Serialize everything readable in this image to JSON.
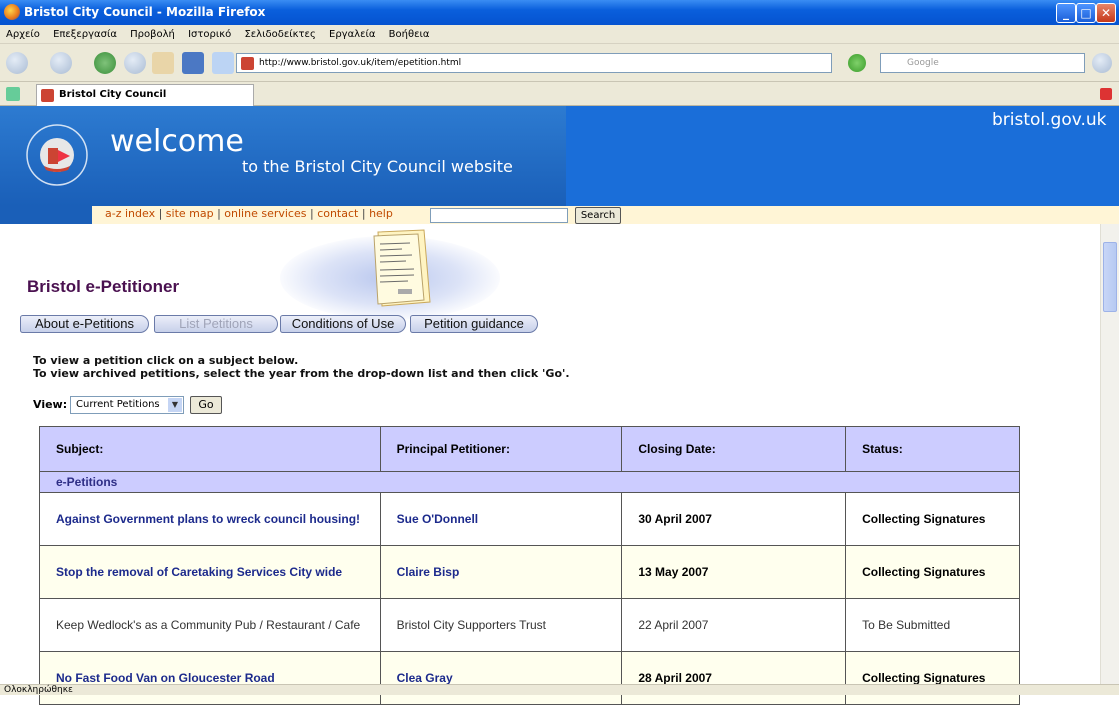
{
  "window": {
    "title": "Bristol City Council - Mozilla Firefox"
  },
  "menu": [
    "Αρχείο",
    "Επεξεργασία",
    "Προβολή",
    "Ιστορικό",
    "Σελιδοδείκτες",
    "Εργαλεία",
    "Βοήθεια"
  ],
  "navbar": {
    "url": "http://www.bristol.gov.uk/item/epetition.html",
    "search_placeholder": "Google"
  },
  "tab": {
    "title": "Bristol City Council"
  },
  "header": {
    "welcome": "welcome",
    "subtitle": "to the Bristol City Council website",
    "domain": "bristol.gov.uk",
    "links": [
      "a-z index",
      "site map",
      "online services",
      "contact",
      "help"
    ],
    "search_button": "Search"
  },
  "page": {
    "title": "Bristol e-Petitioner",
    "tabs": [
      "About e-Petitions",
      "List Petitions",
      "Conditions of Use",
      "Petition guidance"
    ],
    "instructions": [
      "To view a petition click on a subject below.",
      "To view archived petitions, select the year from the drop-down list and then click 'Go'."
    ],
    "view_label": "View:",
    "view_selected": "Current Petitions",
    "go_button": "Go"
  },
  "table": {
    "headers": [
      "Subject:",
      "Principal Petitioner:",
      "Closing Date:",
      "Status:"
    ],
    "group": "e-Petitions",
    "rows": [
      {
        "subject": "Against Government plans to wreck council housing!",
        "petitioner": "Sue O'Donnell",
        "date": "30 April 2007",
        "status": "Collecting Signatures"
      },
      {
        "subject": "Stop the removal of Caretaking Services City wide",
        "petitioner": "Claire Bisp",
        "date": "13 May 2007",
        "status": "Collecting Signatures"
      },
      {
        "subject": "Keep Wedlock's as a Community Pub / Restaurant / Cafe",
        "petitioner": "Bristol City Supporters Trust",
        "date": "22 April 2007",
        "status": "To Be Submitted"
      },
      {
        "subject": "No Fast Food Van on Gloucester Road",
        "petitioner": "Clea Gray",
        "date": "28 April 2007",
        "status": "Collecting Signatures"
      }
    ]
  },
  "statusbar": {
    "text": "Ολοκληρώθηκε"
  }
}
